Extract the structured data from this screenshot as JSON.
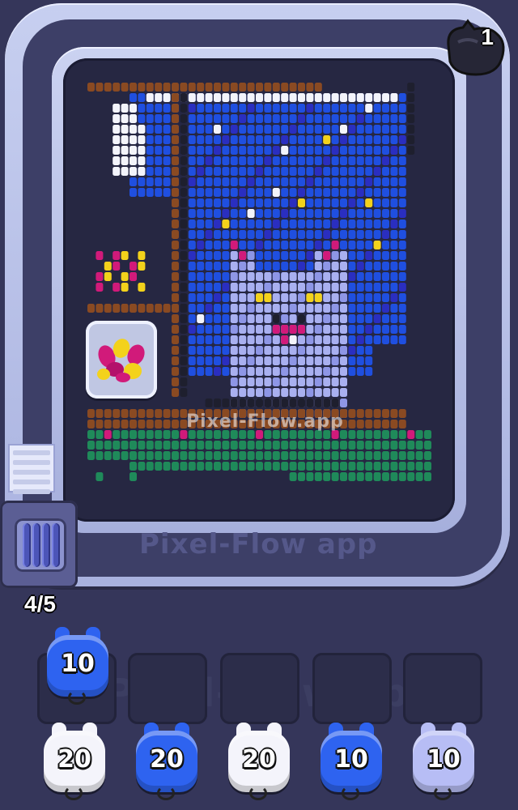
{
  "watermark": "Pixel-Flow.app",
  "watermark_short": "Pixel-Flow app",
  "cat_counter": {
    "value": "1",
    "icon": "cat-paw-icon"
  },
  "progress": "4/5",
  "colors": {
    "blue": "#1f4fe0",
    "navy": "#2a2ec0",
    "white": "#f3f4fb",
    "lavender": "#a9b0f0",
    "brown": "#8a4a22",
    "green": "#1f8a5a",
    "magenta": "#d11a7a",
    "yellow": "#f3d21b",
    "dark": "#1e1f2e"
  },
  "queue_slots": [
    {
      "shooter": {
        "count": "10",
        "color": "#2e63f0"
      }
    },
    {
      "shooter": null
    },
    {
      "shooter": null
    },
    {
      "shooter": null
    },
    {
      "shooter": null
    }
  ],
  "reserve_shooters": [
    {
      "count": "20",
      "color": "#f4f4fb"
    },
    {
      "count": "20",
      "color": "#2e63f0"
    },
    {
      "count": "20",
      "color": "#f4f4fb"
    },
    {
      "count": "10",
      "color": "#2e63f0"
    },
    {
      "count": "10",
      "color": "#b7bdf5"
    }
  ]
}
